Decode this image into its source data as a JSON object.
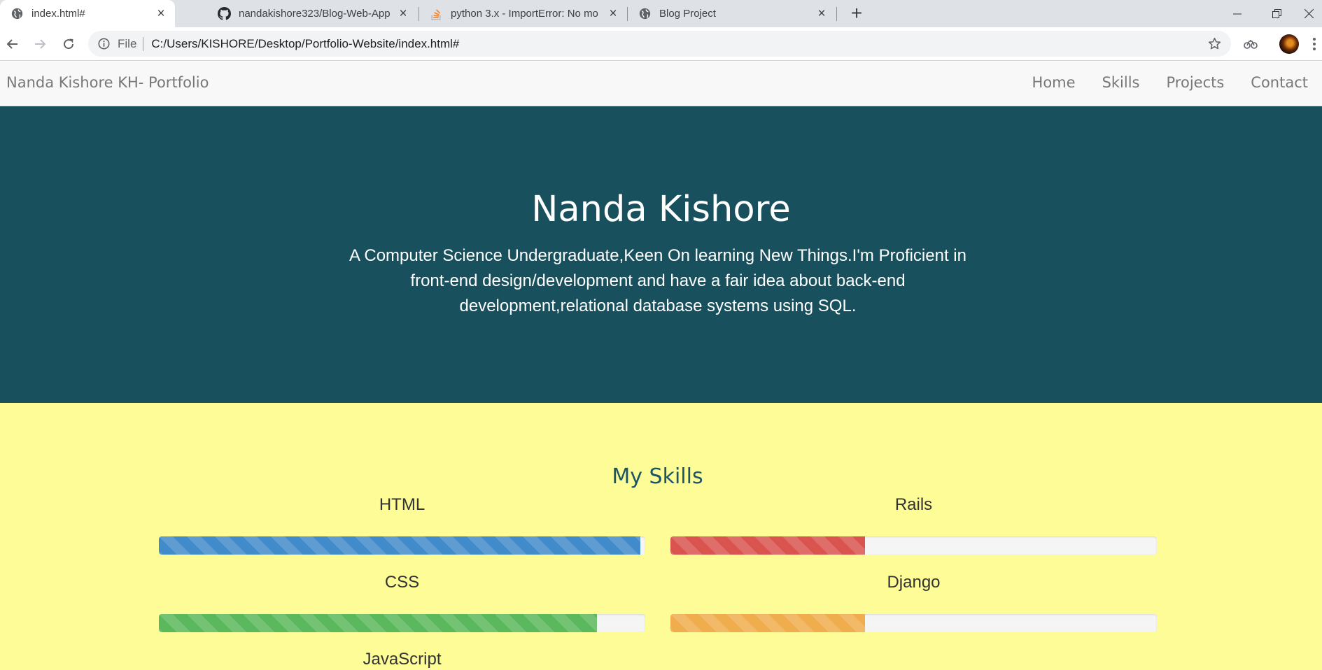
{
  "browser": {
    "tabs": [
      {
        "title": "index.html#",
        "icon": "globe-icon",
        "active": true
      },
      {
        "title": "nandakishore323/Blog-Web-App",
        "icon": "github-icon",
        "active": false
      },
      {
        "title": "python 3.x - ImportError: No mo",
        "icon": "stackoverflow-icon",
        "active": false
      },
      {
        "title": "Blog Project",
        "icon": "globe-icon",
        "active": false
      }
    ],
    "scheme_label": "File",
    "url": "C:/Users/KISHORE/Desktop/Portfolio-Website/index.html#"
  },
  "site": {
    "brand": "Nanda Kishore KH- Portfolio",
    "nav": [
      "Home",
      "Skills",
      "Projects",
      "Contact"
    ],
    "hero": {
      "name": "Nanda Kishore",
      "bio": "A Computer Science Undergraduate,Keen On learning New Things.I'm Proficient in front-end design/development and have a fair idea about back-end development,relational database systems using SQL."
    },
    "skills_title": "My Skills",
    "skills": [
      {
        "name": "HTML",
        "level": 0.99,
        "color": "#428bca"
      },
      {
        "name": "Rails",
        "level": 0.4,
        "color": "#d9534f"
      },
      {
        "name": "CSS",
        "level": 0.9,
        "color": "#5cb85c"
      },
      {
        "name": "Django",
        "level": 0.4,
        "color": "#f0ad4e"
      },
      {
        "name": "JavaScript",
        "level": null,
        "color": "#5bc0de"
      }
    ]
  },
  "colors": {
    "hero_bg": "#18505d",
    "skills_bg": "#fdfc96",
    "navbar_bg": "#f8f8f8"
  }
}
